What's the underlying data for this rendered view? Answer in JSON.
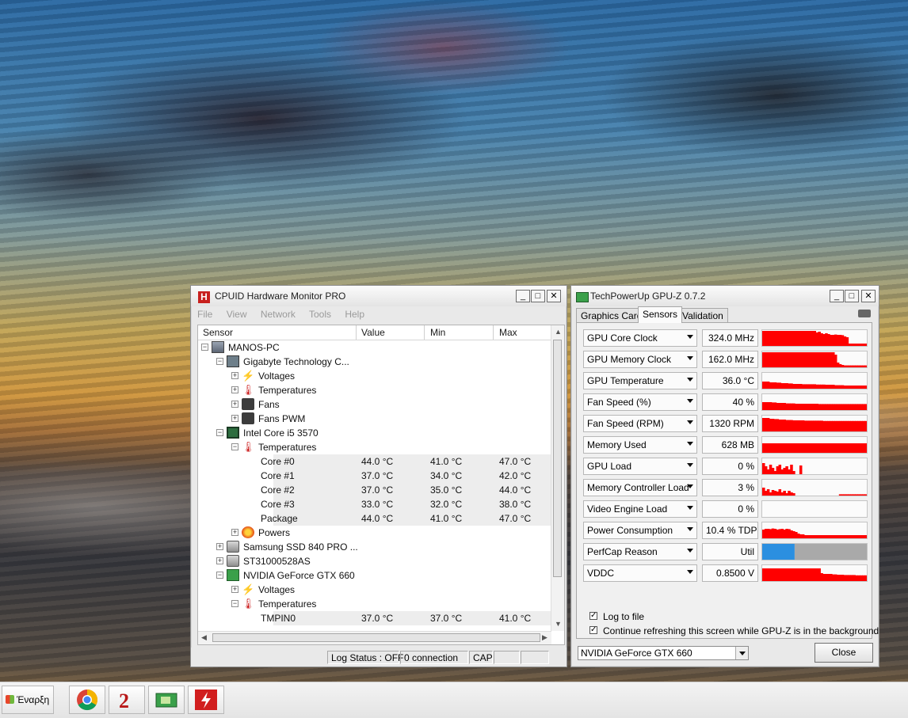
{
  "colors": {
    "graph_red": "#ff0000",
    "perfcap_blue": "#2b8fe0",
    "perfcap_gray": "#a9a9a9",
    "hw_accent": "#c8201e"
  },
  "hwmonitor": {
    "title": "CPUID Hardware Monitor PRO",
    "icon_letter": "H",
    "menu": [
      "File",
      "View",
      "Network",
      "Tools",
      "Help"
    ],
    "columns": [
      "Sensor",
      "Value",
      "Min",
      "Max"
    ],
    "rows": [
      {
        "label": "MANOS-PC",
        "icon": "computer-icon",
        "expander": "-"
      },
      {
        "label": "Gigabyte Technology C...",
        "icon": "motherboard-icon",
        "expander": "-"
      },
      {
        "label": "Voltages",
        "icon": "voltage-icon",
        "expander": "+"
      },
      {
        "label": "Temperatures",
        "icon": "thermometer-icon",
        "expander": "+"
      },
      {
        "label": "Fans",
        "icon": "fan-icon",
        "expander": "+"
      },
      {
        "label": "Fans PWM",
        "icon": "fan-icon",
        "expander": "+"
      },
      {
        "label": "Intel Core i5 3570",
        "icon": "cpu-icon",
        "expander": "-"
      },
      {
        "label": "Temperatures",
        "icon": "thermometer-icon",
        "expander": "-"
      },
      {
        "label": "Core #0",
        "value": "44.0 °C",
        "min": "41.0 °C",
        "max": "47.0 °C"
      },
      {
        "label": "Core #1",
        "value": "37.0 °C",
        "min": "34.0 °C",
        "max": "42.0 °C"
      },
      {
        "label": "Core #2",
        "value": "37.0 °C",
        "min": "35.0 °C",
        "max": "44.0 °C"
      },
      {
        "label": "Core #3",
        "value": "33.0 °C",
        "min": "32.0 °C",
        "max": "38.0 °C"
      },
      {
        "label": "Package",
        "value": "44.0 °C",
        "min": "41.0 °C",
        "max": "47.0 °C"
      },
      {
        "label": "Powers",
        "icon": "power-icon",
        "expander": "+"
      },
      {
        "label": "Samsung SSD 840 PRO ...",
        "icon": "disk-icon",
        "expander": "+"
      },
      {
        "label": "ST31000528AS",
        "icon": "disk-icon",
        "expander": "+"
      },
      {
        "label": "NVIDIA GeForce GTX 660",
        "icon": "gpu-icon",
        "expander": "-"
      },
      {
        "label": "Voltages",
        "icon": "voltage-icon",
        "expander": "+"
      },
      {
        "label": "Temperatures",
        "icon": "thermometer-icon",
        "expander": "-"
      },
      {
        "label": "TMPIN0",
        "value": "37.0 °C",
        "min": "37.0 °C",
        "max": "41.0 °C"
      }
    ],
    "status": {
      "log": "Log Status : OFF",
      "connection": "0 connection",
      "cap": "CAP"
    }
  },
  "gpuz": {
    "title": "TechPowerUp GPU-Z 0.7.2",
    "tabs": [
      "Graphics Card",
      "Sensors",
      "Validation"
    ],
    "active_tab": "Sensors",
    "sensors": [
      {
        "name": "GPU Core Clock",
        "value": "324.0 MHz",
        "graph": [
          0.95,
          0.95,
          0.95,
          0.95,
          0.95,
          0.95,
          0.95,
          0.95,
          0.95,
          0.95,
          0.95,
          0.95,
          0.95,
          0.95,
          0.95,
          0.95,
          0.95,
          0.95,
          0.95,
          0.95,
          0.95,
          0.95,
          0.95,
          0.85,
          0.9,
          0.8,
          0.75,
          0.8,
          0.75,
          0.7,
          0.7,
          0.72,
          0.7,
          0.7,
          0.68,
          0.6,
          0.55,
          0.15,
          0.15,
          0.15,
          0.15,
          0.15,
          0.15,
          0.15,
          0.15
        ]
      },
      {
        "name": "GPU Memory Clock",
        "value": "162.0 MHz",
        "graph": [
          0.95,
          0.95,
          0.95,
          0.95,
          0.95,
          0.95,
          0.95,
          0.95,
          0.95,
          0.95,
          0.95,
          0.95,
          0.95,
          0.95,
          0.95,
          0.95,
          0.95,
          0.95,
          0.95,
          0.95,
          0.95,
          0.95,
          0.95,
          0.95,
          0.95,
          0.95,
          0.95,
          0.95,
          0.95,
          0.95,
          0.95,
          0.8,
          0.3,
          0.2,
          0.15,
          0.12,
          0.12,
          0.12,
          0.12,
          0.12,
          0.12,
          0.12,
          0.12,
          0.12,
          0.12
        ]
      },
      {
        "name": "GPU Temperature",
        "value": "36.0 °C",
        "graph": [
          0.45,
          0.45,
          0.45,
          0.4,
          0.4,
          0.4,
          0.38,
          0.38,
          0.35,
          0.35,
          0.35,
          0.33,
          0.33,
          0.3,
          0.3,
          0.3,
          0.3,
          0.28,
          0.28,
          0.28,
          0.28,
          0.28,
          0.28,
          0.26,
          0.26,
          0.26,
          0.26,
          0.25,
          0.25,
          0.25,
          0.25,
          0.22,
          0.22,
          0.22,
          0.22,
          0.2,
          0.2,
          0.2,
          0.2,
          0.2,
          0.2,
          0.2,
          0.2,
          0.2,
          0.2
        ]
      },
      {
        "name": "Fan Speed (%)",
        "value": "40 %",
        "graph": [
          0.5,
          0.5,
          0.5,
          0.5,
          0.48,
          0.48,
          0.45,
          0.45,
          0.45,
          0.45,
          0.42,
          0.42,
          0.42,
          0.42,
          0.4,
          0.4,
          0.4,
          0.4,
          0.4,
          0.4,
          0.4,
          0.4,
          0.4,
          0.4,
          0.38,
          0.38,
          0.38,
          0.38,
          0.38,
          0.38,
          0.38,
          0.38,
          0.38,
          0.38,
          0.38,
          0.38,
          0.38,
          0.38,
          0.38,
          0.38,
          0.38,
          0.38,
          0.38,
          0.38,
          0.38
        ]
      },
      {
        "name": "Fan Speed (RPM)",
        "value": "1320 RPM",
        "graph": [
          0.85,
          0.85,
          0.85,
          0.8,
          0.8,
          0.78,
          0.78,
          0.75,
          0.75,
          0.75,
          0.72,
          0.72,
          0.72,
          0.7,
          0.7,
          0.7,
          0.7,
          0.7,
          0.68,
          0.68,
          0.68,
          0.68,
          0.68,
          0.68,
          0.68,
          0.68,
          0.66,
          0.66,
          0.66,
          0.66,
          0.66,
          0.66,
          0.66,
          0.66,
          0.66,
          0.66,
          0.66,
          0.66,
          0.66,
          0.66,
          0.66,
          0.66,
          0.66,
          0.66,
          0.66
        ]
      },
      {
        "name": "Memory Used",
        "value": "628 MB",
        "graph": [
          0.6,
          0.6,
          0.6,
          0.6,
          0.6,
          0.6,
          0.6,
          0.6,
          0.6,
          0.6,
          0.6,
          0.6,
          0.6,
          0.6,
          0.6,
          0.6,
          0.6,
          0.6,
          0.6,
          0.6,
          0.6,
          0.6,
          0.6,
          0.6,
          0.6,
          0.6,
          0.6,
          0.6,
          0.6,
          0.6,
          0.6,
          0.6,
          0.6,
          0.6,
          0.6,
          0.6,
          0.6,
          0.6,
          0.6,
          0.6,
          0.6,
          0.6,
          0.6,
          0.6,
          0.6
        ]
      },
      {
        "name": "GPU Load",
        "value": "0 %",
        "graph": [
          0.7,
          0.5,
          0.3,
          0.6,
          0.4,
          0.2,
          0.5,
          0.6,
          0.3,
          0.4,
          0.5,
          0.3,
          0.6,
          0.2,
          0.0,
          0.0,
          0.55,
          0.0,
          0.0,
          0.0,
          0.0,
          0.0,
          0.0,
          0.0,
          0.0,
          0.0,
          0.0,
          0.0,
          0.0,
          0.0,
          0.0,
          0.0,
          0.0,
          0.0,
          0.0,
          0.0,
          0.0,
          0.0,
          0.0,
          0.0,
          0.0,
          0.0,
          0.0,
          0.0,
          0.0
        ]
      },
      {
        "name": "Memory Controller Load",
        "value": "3 %",
        "graph": [
          0.5,
          0.3,
          0.4,
          0.2,
          0.35,
          0.3,
          0.25,
          0.4,
          0.2,
          0.3,
          0.15,
          0.3,
          0.2,
          0.15,
          0.0,
          0.0,
          0.0,
          0.0,
          0.0,
          0.0,
          0.0,
          0.0,
          0.0,
          0.0,
          0.0,
          0.0,
          0.0,
          0.0,
          0.0,
          0.0,
          0.0,
          0.0,
          0.0,
          0.08,
          0.08,
          0.08,
          0.08,
          0.08,
          0.08,
          0.08,
          0.08,
          0.08,
          0.08,
          0.08,
          0.08
        ]
      },
      {
        "name": "Video Engine Load",
        "value": "0 %",
        "graph": [
          0,
          0,
          0,
          0,
          0,
          0,
          0,
          0,
          0,
          0,
          0,
          0,
          0,
          0,
          0,
          0,
          0,
          0,
          0,
          0,
          0,
          0,
          0,
          0,
          0,
          0,
          0,
          0,
          0,
          0,
          0,
          0,
          0,
          0,
          0,
          0,
          0,
          0,
          0,
          0,
          0,
          0,
          0,
          0,
          0
        ]
      },
      {
        "name": "Power Consumption",
        "value": "10.4 % TDP",
        "graph": [
          0.55,
          0.6,
          0.6,
          0.58,
          0.62,
          0.6,
          0.55,
          0.58,
          0.6,
          0.55,
          0.6,
          0.58,
          0.5,
          0.45,
          0.4,
          0.3,
          0.25,
          0.25,
          0.2,
          0.2,
          0.2,
          0.2,
          0.2,
          0.2,
          0.2,
          0.2,
          0.2,
          0.2,
          0.2,
          0.2,
          0.2,
          0.2,
          0.2,
          0.2,
          0.2,
          0.2,
          0.2,
          0.2,
          0.2,
          0.2,
          0.2,
          0.2,
          0.2,
          0.2,
          0.2
        ]
      },
      {
        "name": "PerfCap Reason",
        "value": "Util",
        "perfcap_util_fraction": 0.31
      },
      {
        "name": "VDDC",
        "value": "0.8500 V",
        "graph": [
          0.8,
          0.8,
          0.8,
          0.8,
          0.8,
          0.8,
          0.8,
          0.8,
          0.8,
          0.8,
          0.8,
          0.8,
          0.8,
          0.8,
          0.8,
          0.8,
          0.8,
          0.8,
          0.8,
          0.8,
          0.8,
          0.8,
          0.8,
          0.8,
          0.8,
          0.5,
          0.45,
          0.45,
          0.45,
          0.45,
          0.42,
          0.42,
          0.4,
          0.4,
          0.4,
          0.38,
          0.38,
          0.38,
          0.38,
          0.38,
          0.36,
          0.36,
          0.36,
          0.36,
          0.36
        ]
      }
    ],
    "log_to_file": "Log to file",
    "continue_refresh": "Continue refreshing this screen while GPU-Z is in the background",
    "selected_card": "NVIDIA GeForce GTX 660",
    "close_label": "Close"
  },
  "taskbar": {
    "start_label": "Έναρξη",
    "apps": [
      "chrome-icon",
      "guild-wars-2-icon",
      "gpu-z-icon",
      "pdf-app-icon"
    ]
  }
}
